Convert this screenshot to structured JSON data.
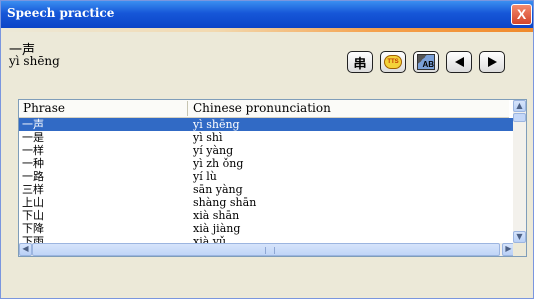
{
  "window": {
    "title": "Speech practice",
    "close_glyph": "X"
  },
  "current": {
    "word": "一声",
    "pinyin": "yì shēng"
  },
  "toolbar": {
    "buttons": [
      {
        "name": "character-icon",
        "glyph": "串"
      },
      {
        "name": "tts-icon",
        "glyph": "TTS"
      },
      {
        "name": "dictionary-icon",
        "glyph": "AB"
      },
      {
        "name": "previous-arrow-icon",
        "glyph": ""
      },
      {
        "name": "next-arrow-icon",
        "glyph": ""
      }
    ]
  },
  "table": {
    "headers": [
      "Phrase",
      "Chinese pronunciation"
    ],
    "selected_index": 0,
    "rows": [
      {
        "phrase": "一声",
        "pron": "yì shēng"
      },
      {
        "phrase": "一是",
        "pron": "yì shì"
      },
      {
        "phrase": "一样",
        "pron": "yí yàng"
      },
      {
        "phrase": "一种",
        "pron": "yì zh ǒng"
      },
      {
        "phrase": "一路",
        "pron": "yí lù"
      },
      {
        "phrase": "三样",
        "pron": "sān yàng"
      },
      {
        "phrase": "上山",
        "pron": "shàng shān"
      },
      {
        "phrase": "下山",
        "pron": "xià shān"
      },
      {
        "phrase": "下降",
        "pron": "xià jiàng"
      },
      {
        "phrase": "下雨",
        "pron": "xià yǔ"
      }
    ]
  },
  "colors": {
    "selection": "#316ac5",
    "titlebar": "#0b44c7"
  }
}
